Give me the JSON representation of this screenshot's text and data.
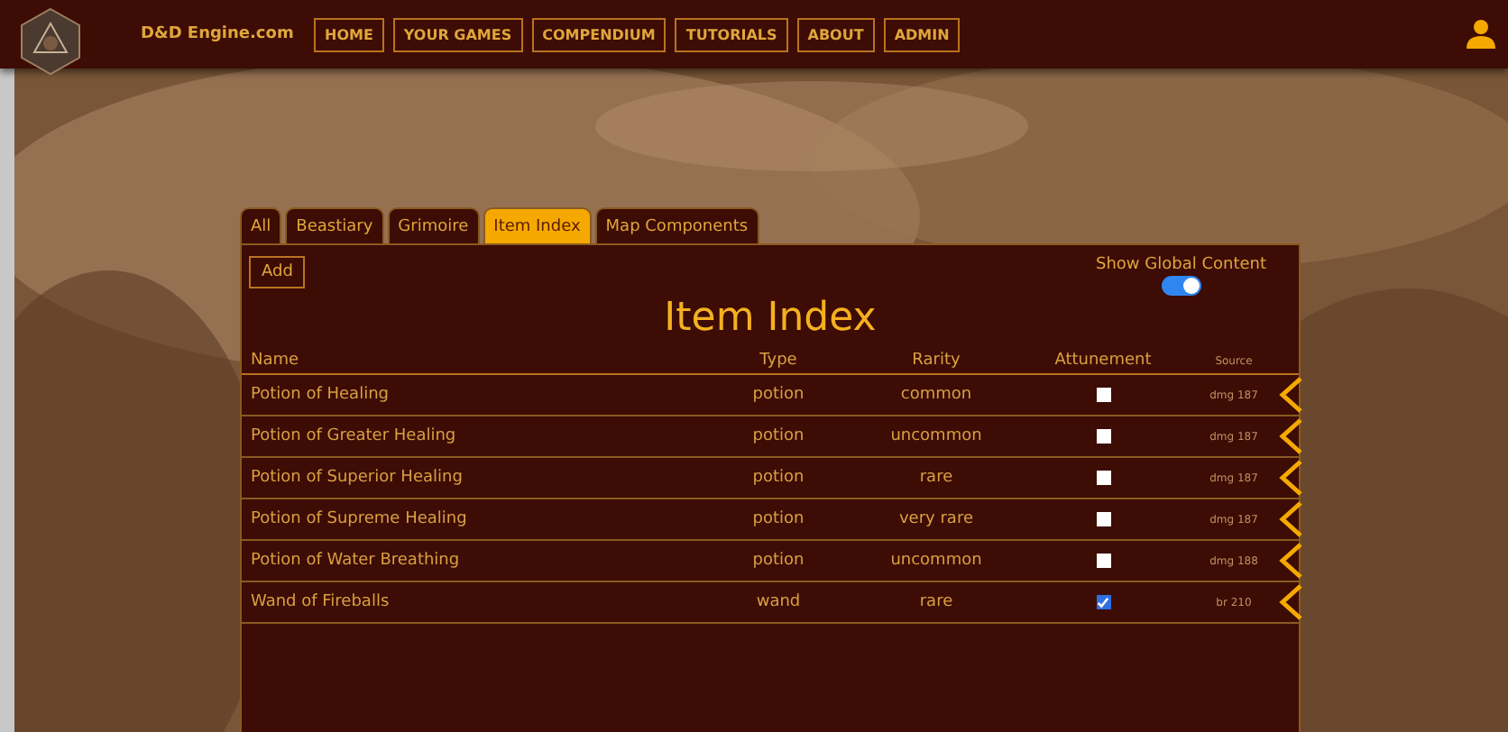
{
  "site": {
    "name": "D&D Engine.com"
  },
  "nav": [
    "HOME",
    "YOUR GAMES",
    "COMPENDIUM",
    "TUTORIALS",
    "ABOUT",
    "ADMIN"
  ],
  "tabs": [
    {
      "label": "All",
      "selected": false
    },
    {
      "label": "Beastiary",
      "selected": false
    },
    {
      "label": "Grimoire",
      "selected": false
    },
    {
      "label": "Item Index",
      "selected": true
    },
    {
      "label": "Map Components",
      "selected": false
    }
  ],
  "add_button": "Add",
  "global_toggle": {
    "label": "Show Global Content",
    "on": true
  },
  "title": "Item Index",
  "table": {
    "columns": [
      "Name",
      "Type",
      "Rarity",
      "Attunement",
      "Source"
    ],
    "rows": [
      {
        "name": "Potion of Healing",
        "type": "potion",
        "rarity": "common",
        "attunement": false,
        "source": "dmg 187"
      },
      {
        "name": "Potion of Greater Healing",
        "type": "potion",
        "rarity": "uncommon",
        "attunement": false,
        "source": "dmg 187"
      },
      {
        "name": "Potion of Superior Healing",
        "type": "potion",
        "rarity": "rare",
        "attunement": false,
        "source": "dmg 187"
      },
      {
        "name": "Potion of Supreme Healing",
        "type": "potion",
        "rarity": "very rare",
        "attunement": false,
        "source": "dmg 187"
      },
      {
        "name": "Potion of Water Breathing",
        "type": "potion",
        "rarity": "uncommon",
        "attunement": false,
        "source": "dmg 188"
      },
      {
        "name": "Wand of Fireballs",
        "type": "wand",
        "rarity": "rare",
        "attunement": true,
        "source": "br 210"
      }
    ]
  }
}
